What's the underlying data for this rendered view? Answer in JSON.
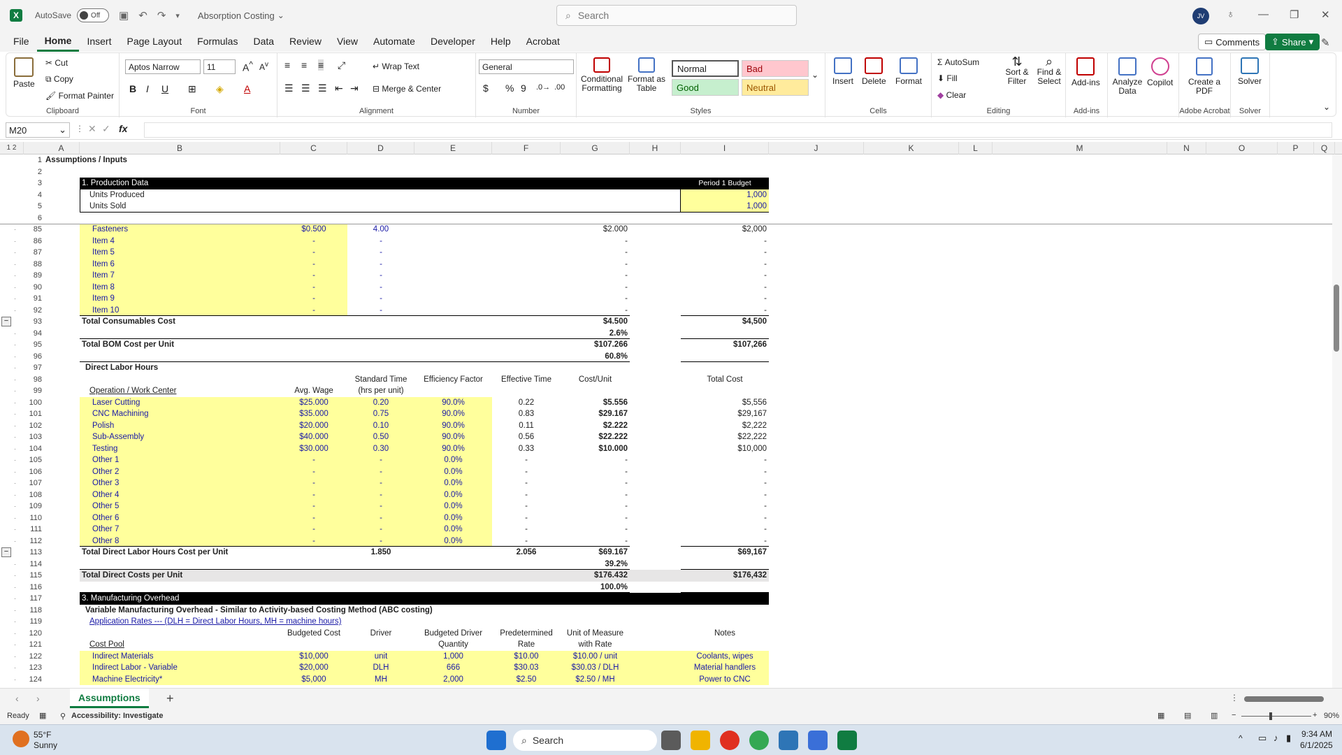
{
  "titlebar": {
    "autosave_label": "AutoSave",
    "autosave_state": "Off",
    "doc_title": "Absorption Costing",
    "search_placeholder": "Search",
    "avatar": "JV"
  },
  "menu": [
    "File",
    "Home",
    "Insert",
    "Page Layout",
    "Formulas",
    "Data",
    "Review",
    "View",
    "Automate",
    "Developer",
    "Help",
    "Acrobat"
  ],
  "menu_right": {
    "comments": "Comments",
    "share": "Share"
  },
  "ribbon": {
    "clipboard": {
      "paste": "Paste",
      "cut": "Cut",
      "copy": "Copy",
      "format_painter": "Format Painter",
      "label": "Clipboard"
    },
    "font": {
      "name": "Aptos Narrow",
      "size": "11",
      "label": "Font"
    },
    "alignment": {
      "wrap": "Wrap Text",
      "merge": "Merge & Center",
      "label": "Alignment"
    },
    "number": {
      "format": "General",
      "label": "Number"
    },
    "styles": {
      "cond": "Conditional Formatting",
      "table": "Format as Table",
      "normal": "Normal",
      "bad": "Bad",
      "good": "Good",
      "neutral": "Neutral",
      "label": "Styles"
    },
    "cells": {
      "insert": "Insert",
      "delete": "Delete",
      "format": "Format",
      "label": "Cells"
    },
    "editing": {
      "autosum": "AutoSum",
      "fill": "Fill",
      "clear": "Clear",
      "sort": "Sort & Filter",
      "find": "Find & Select",
      "label": "Editing"
    },
    "addins": {
      "addins": "Add-ins",
      "label": "Add-ins"
    },
    "analyze": "Analyze Data",
    "copilot": "Copilot",
    "acrobat": {
      "create": "Create a PDF",
      "label": "Adobe Acrobat"
    },
    "solver": {
      "solver": "Solver",
      "label": "Solver"
    }
  },
  "formula_bar": {
    "name_box": "M20",
    "formula": ""
  },
  "columns": [
    "A",
    "B",
    "C",
    "D",
    "E",
    "F",
    "G",
    "H",
    "I",
    "J",
    "K",
    "L",
    "M",
    "N",
    "O",
    "P",
    "Q"
  ],
  "rows": [
    {
      "n": "1",
      "cells": [
        {
          "c": "A",
          "t": "Assumptions / Inputs"
        }
      ]
    },
    {
      "n": "2",
      "cells": []
    },
    {
      "n": "3",
      "cells": [
        {
          "c": "B",
          "t": "1. Production Data"
        },
        {
          "c": "I",
          "t": "Period 1 Budget"
        }
      ]
    },
    {
      "n": "4",
      "cells": [
        {
          "c": "B",
          "t": "Units Produced"
        },
        {
          "c": "I",
          "t": "1,000"
        }
      ]
    },
    {
      "n": "5",
      "cells": [
        {
          "c": "B",
          "t": "Units Sold"
        },
        {
          "c": "I",
          "t": "1,000"
        }
      ]
    },
    {
      "n": "6",
      "cells": []
    },
    {
      "n": "85",
      "cells": [
        {
          "c": "B",
          "t": "Fasteners"
        },
        {
          "c": "C",
          "t": "$0.500"
        },
        {
          "c": "D",
          "t": "4.00"
        },
        {
          "c": "G",
          "t": "$2.000"
        },
        {
          "c": "I",
          "t": "$2,000"
        }
      ]
    },
    {
      "n": "86",
      "cells": [
        {
          "c": "B",
          "t": "Item 4"
        },
        {
          "c": "C",
          "t": "-"
        },
        {
          "c": "D",
          "t": "-"
        },
        {
          "c": "G",
          "t": "-"
        },
        {
          "c": "I",
          "t": "-"
        }
      ]
    },
    {
      "n": "87",
      "cells": [
        {
          "c": "B",
          "t": "Item 5"
        },
        {
          "c": "C",
          "t": "-"
        },
        {
          "c": "D",
          "t": "-"
        },
        {
          "c": "G",
          "t": "-"
        },
        {
          "c": "I",
          "t": "-"
        }
      ]
    },
    {
      "n": "88",
      "cells": [
        {
          "c": "B",
          "t": "Item 6"
        },
        {
          "c": "C",
          "t": "-"
        },
        {
          "c": "D",
          "t": "-"
        },
        {
          "c": "G",
          "t": "-"
        },
        {
          "c": "I",
          "t": "-"
        }
      ]
    },
    {
      "n": "89",
      "cells": [
        {
          "c": "B",
          "t": "Item 7"
        },
        {
          "c": "C",
          "t": "-"
        },
        {
          "c": "D",
          "t": "-"
        },
        {
          "c": "G",
          "t": "-"
        },
        {
          "c": "I",
          "t": "-"
        }
      ]
    },
    {
      "n": "90",
      "cells": [
        {
          "c": "B",
          "t": "Item 8"
        },
        {
          "c": "C",
          "t": "-"
        },
        {
          "c": "D",
          "t": "-"
        },
        {
          "c": "G",
          "t": "-"
        },
        {
          "c": "I",
          "t": "-"
        }
      ]
    },
    {
      "n": "91",
      "cells": [
        {
          "c": "B",
          "t": "Item 9"
        },
        {
          "c": "C",
          "t": "-"
        },
        {
          "c": "D",
          "t": "-"
        },
        {
          "c": "G",
          "t": "-"
        },
        {
          "c": "I",
          "t": "-"
        }
      ]
    },
    {
      "n": "92",
      "cells": [
        {
          "c": "B",
          "t": "Item 10"
        },
        {
          "c": "C",
          "t": "-"
        },
        {
          "c": "D",
          "t": "-"
        },
        {
          "c": "G",
          "t": "-"
        },
        {
          "c": "I",
          "t": "-"
        }
      ]
    },
    {
      "n": "93",
      "cells": [
        {
          "c": "B",
          "t": "Total Consumables Cost"
        },
        {
          "c": "G",
          "t": "$4.500"
        },
        {
          "c": "I",
          "t": "$4,500"
        }
      ]
    },
    {
      "n": "94",
      "cells": [
        {
          "c": "G",
          "t": "2.6%"
        }
      ]
    },
    {
      "n": "95",
      "cells": [
        {
          "c": "B",
          "t": "Total BOM Cost per Unit"
        },
        {
          "c": "G",
          "t": "$107.266"
        },
        {
          "c": "I",
          "t": "$107,266"
        }
      ]
    },
    {
      "n": "96",
      "cells": [
        {
          "c": "G",
          "t": "60.8%"
        }
      ]
    },
    {
      "n": "97",
      "cells": [
        {
          "c": "B",
          "t": "Direct Labor Hours"
        }
      ]
    },
    {
      "n": "98",
      "cells": [
        {
          "c": "D",
          "t": "Standard Time"
        },
        {
          "c": "E",
          "t": "Efficiency Factor"
        },
        {
          "c": "F",
          "t": "Effective Time"
        },
        {
          "c": "G",
          "t": "Cost/Unit"
        },
        {
          "c": "I",
          "t": "Total Cost"
        }
      ]
    },
    {
      "n": "99",
      "cells": [
        {
          "c": "B",
          "t": "Operation / Work Center"
        },
        {
          "c": "C",
          "t": "Avg. Wage"
        },
        {
          "c": "D",
          "t": "(hrs per unit)"
        }
      ]
    },
    {
      "n": "100",
      "cells": [
        {
          "c": "B",
          "t": "Laser Cutting"
        },
        {
          "c": "C",
          "t": "$25.000"
        },
        {
          "c": "D",
          "t": "0.20"
        },
        {
          "c": "E",
          "t": "90.0%"
        },
        {
          "c": "F",
          "t": "0.22"
        },
        {
          "c": "G",
          "t": "$5.556"
        },
        {
          "c": "I",
          "t": "$5,556"
        }
      ]
    },
    {
      "n": "101",
      "cells": [
        {
          "c": "B",
          "t": "CNC Machining"
        },
        {
          "c": "C",
          "t": "$35.000"
        },
        {
          "c": "D",
          "t": "0.75"
        },
        {
          "c": "E",
          "t": "90.0%"
        },
        {
          "c": "F",
          "t": "0.83"
        },
        {
          "c": "G",
          "t": "$29.167"
        },
        {
          "c": "I",
          "t": "$29,167"
        }
      ]
    },
    {
      "n": "102",
      "cells": [
        {
          "c": "B",
          "t": "Polish"
        },
        {
          "c": "C",
          "t": "$20.000"
        },
        {
          "c": "D",
          "t": "0.10"
        },
        {
          "c": "E",
          "t": "90.0%"
        },
        {
          "c": "F",
          "t": "0.11"
        },
        {
          "c": "G",
          "t": "$2.222"
        },
        {
          "c": "I",
          "t": "$2,222"
        }
      ]
    },
    {
      "n": "103",
      "cells": [
        {
          "c": "B",
          "t": "Sub-Assembly"
        },
        {
          "c": "C",
          "t": "$40.000"
        },
        {
          "c": "D",
          "t": "0.50"
        },
        {
          "c": "E",
          "t": "90.0%"
        },
        {
          "c": "F",
          "t": "0.56"
        },
        {
          "c": "G",
          "t": "$22.222"
        },
        {
          "c": "I",
          "t": "$22,222"
        }
      ]
    },
    {
      "n": "104",
      "cells": [
        {
          "c": "B",
          "t": "Testing"
        },
        {
          "c": "C",
          "t": "$30.000"
        },
        {
          "c": "D",
          "t": "0.30"
        },
        {
          "c": "E",
          "t": "90.0%"
        },
        {
          "c": "F",
          "t": "0.33"
        },
        {
          "c": "G",
          "t": "$10.000"
        },
        {
          "c": "I",
          "t": "$10,000"
        }
      ]
    },
    {
      "n": "105",
      "cells": [
        {
          "c": "B",
          "t": "Other 1"
        },
        {
          "c": "C",
          "t": "-"
        },
        {
          "c": "D",
          "t": "-"
        },
        {
          "c": "E",
          "t": "0.0%"
        },
        {
          "c": "F",
          "t": "-"
        },
        {
          "c": "G",
          "t": "-"
        },
        {
          "c": "I",
          "t": "-"
        }
      ]
    },
    {
      "n": "106",
      "cells": [
        {
          "c": "B",
          "t": "Other 2"
        },
        {
          "c": "C",
          "t": "-"
        },
        {
          "c": "D",
          "t": "-"
        },
        {
          "c": "E",
          "t": "0.0%"
        },
        {
          "c": "F",
          "t": "-"
        },
        {
          "c": "G",
          "t": "-"
        },
        {
          "c": "I",
          "t": "-"
        }
      ]
    },
    {
      "n": "107",
      "cells": [
        {
          "c": "B",
          "t": "Other 3"
        },
        {
          "c": "C",
          "t": "-"
        },
        {
          "c": "D",
          "t": "-"
        },
        {
          "c": "E",
          "t": "0.0%"
        },
        {
          "c": "F",
          "t": "-"
        },
        {
          "c": "G",
          "t": "-"
        },
        {
          "c": "I",
          "t": "-"
        }
      ]
    },
    {
      "n": "108",
      "cells": [
        {
          "c": "B",
          "t": "Other 4"
        },
        {
          "c": "C",
          "t": "-"
        },
        {
          "c": "D",
          "t": "-"
        },
        {
          "c": "E",
          "t": "0.0%"
        },
        {
          "c": "F",
          "t": "-"
        },
        {
          "c": "G",
          "t": "-"
        },
        {
          "c": "I",
          "t": "-"
        }
      ]
    },
    {
      "n": "109",
      "cells": [
        {
          "c": "B",
          "t": "Other 5"
        },
        {
          "c": "C",
          "t": "-"
        },
        {
          "c": "D",
          "t": "-"
        },
        {
          "c": "E",
          "t": "0.0%"
        },
        {
          "c": "F",
          "t": "-"
        },
        {
          "c": "G",
          "t": "-"
        },
        {
          "c": "I",
          "t": "-"
        }
      ]
    },
    {
      "n": "110",
      "cells": [
        {
          "c": "B",
          "t": "Other 6"
        },
        {
          "c": "C",
          "t": "-"
        },
        {
          "c": "D",
          "t": "-"
        },
        {
          "c": "E",
          "t": "0.0%"
        },
        {
          "c": "F",
          "t": "-"
        },
        {
          "c": "G",
          "t": "-"
        },
        {
          "c": "I",
          "t": "-"
        }
      ]
    },
    {
      "n": "111",
      "cells": [
        {
          "c": "B",
          "t": "Other 7"
        },
        {
          "c": "C",
          "t": "-"
        },
        {
          "c": "D",
          "t": "-"
        },
        {
          "c": "E",
          "t": "0.0%"
        },
        {
          "c": "F",
          "t": "-"
        },
        {
          "c": "G",
          "t": "-"
        },
        {
          "c": "I",
          "t": "-"
        }
      ]
    },
    {
      "n": "112",
      "cells": [
        {
          "c": "B",
          "t": "Other 8"
        },
        {
          "c": "C",
          "t": "-"
        },
        {
          "c": "D",
          "t": "-"
        },
        {
          "c": "E",
          "t": "0.0%"
        },
        {
          "c": "F",
          "t": "-"
        },
        {
          "c": "G",
          "t": "-"
        },
        {
          "c": "I",
          "t": "-"
        }
      ]
    },
    {
      "n": "113",
      "cells": [
        {
          "c": "B",
          "t": "Total Direct Labor Hours Cost per Unit"
        },
        {
          "c": "D",
          "t": "1.850"
        },
        {
          "c": "F",
          "t": "2.056"
        },
        {
          "c": "G",
          "t": "$69.167"
        },
        {
          "c": "I",
          "t": "$69,167"
        }
      ]
    },
    {
      "n": "114",
      "cells": [
        {
          "c": "G",
          "t": "39.2%"
        }
      ]
    },
    {
      "n": "115",
      "cells": [
        {
          "c": "B",
          "t": "Total Direct Costs per Unit"
        },
        {
          "c": "G",
          "t": "$176.432"
        },
        {
          "c": "I",
          "t": "$176,432"
        }
      ]
    },
    {
      "n": "116",
      "cells": [
        {
          "c": "G",
          "t": "100.0%"
        }
      ]
    },
    {
      "n": "117",
      "cells": [
        {
          "c": "B",
          "t": "3. Manufacturing Overhead"
        }
      ]
    },
    {
      "n": "118",
      "cells": [
        {
          "c": "B",
          "t": "Variable Manufacturing Overhead - Similar to Activity-based Costing Method (ABC costing)"
        }
      ]
    },
    {
      "n": "119",
      "cells": [
        {
          "c": "B",
          "t": "Application Rates --- (DLH = Direct Labor Hours, MH = machine hours)"
        }
      ]
    },
    {
      "n": "120",
      "cells": [
        {
          "c": "C",
          "t": "Budgeted Cost"
        },
        {
          "c": "D",
          "t": "Driver"
        },
        {
          "c": "E",
          "t": "Budgeted Driver"
        },
        {
          "c": "F",
          "t": "Predetermined"
        },
        {
          "c": "G",
          "t": "Unit of Measure"
        },
        {
          "c": "I",
          "t": "Notes"
        }
      ]
    },
    {
      "n": "121",
      "cells": [
        {
          "c": "B",
          "t": "Cost Pool"
        },
        {
          "c": "E",
          "t": "Quantity"
        },
        {
          "c": "F",
          "t": "Rate"
        },
        {
          "c": "G",
          "t": "with Rate"
        }
      ]
    },
    {
      "n": "122",
      "cells": [
        {
          "c": "B",
          "t": "Indirect Materials"
        },
        {
          "c": "C",
          "t": "$10,000"
        },
        {
          "c": "D",
          "t": "unit"
        },
        {
          "c": "E",
          "t": "1,000"
        },
        {
          "c": "F",
          "t": "$10.00"
        },
        {
          "c": "G",
          "t": "$10.00 / unit"
        },
        {
          "c": "I",
          "t": "Coolants, wipes"
        }
      ]
    },
    {
      "n": "123",
      "cells": [
        {
          "c": "B",
          "t": "Indirect Labor - Variable"
        },
        {
          "c": "C",
          "t": "$20,000"
        },
        {
          "c": "D",
          "t": "DLH"
        },
        {
          "c": "E",
          "t": "666"
        },
        {
          "c": "F",
          "t": "$30.03"
        },
        {
          "c": "G",
          "t": "$30.03 / DLH"
        },
        {
          "c": "I",
          "t": "Material handlers"
        }
      ]
    },
    {
      "n": "124",
      "cells": [
        {
          "c": "B",
          "t": "Machine Electricity*"
        },
        {
          "c": "C",
          "t": "$5,000"
        },
        {
          "c": "D",
          "t": "MH"
        },
        {
          "c": "E",
          "t": "2,000"
        },
        {
          "c": "F",
          "t": "$2.50"
        },
        {
          "c": "G",
          "t": "$2.50 / MH"
        },
        {
          "c": "I",
          "t": "Power to CNC"
        }
      ]
    }
  ],
  "sheet_tab": "Assumptions",
  "status": {
    "ready": "Ready",
    "accessibility": "Accessibility: Investigate",
    "zoom": "90%"
  },
  "taskbar": {
    "weather_temp": "55°F",
    "weather_desc": "Sunny",
    "search": "Search",
    "time": "9:34 AM",
    "date": "6/1/2025"
  }
}
